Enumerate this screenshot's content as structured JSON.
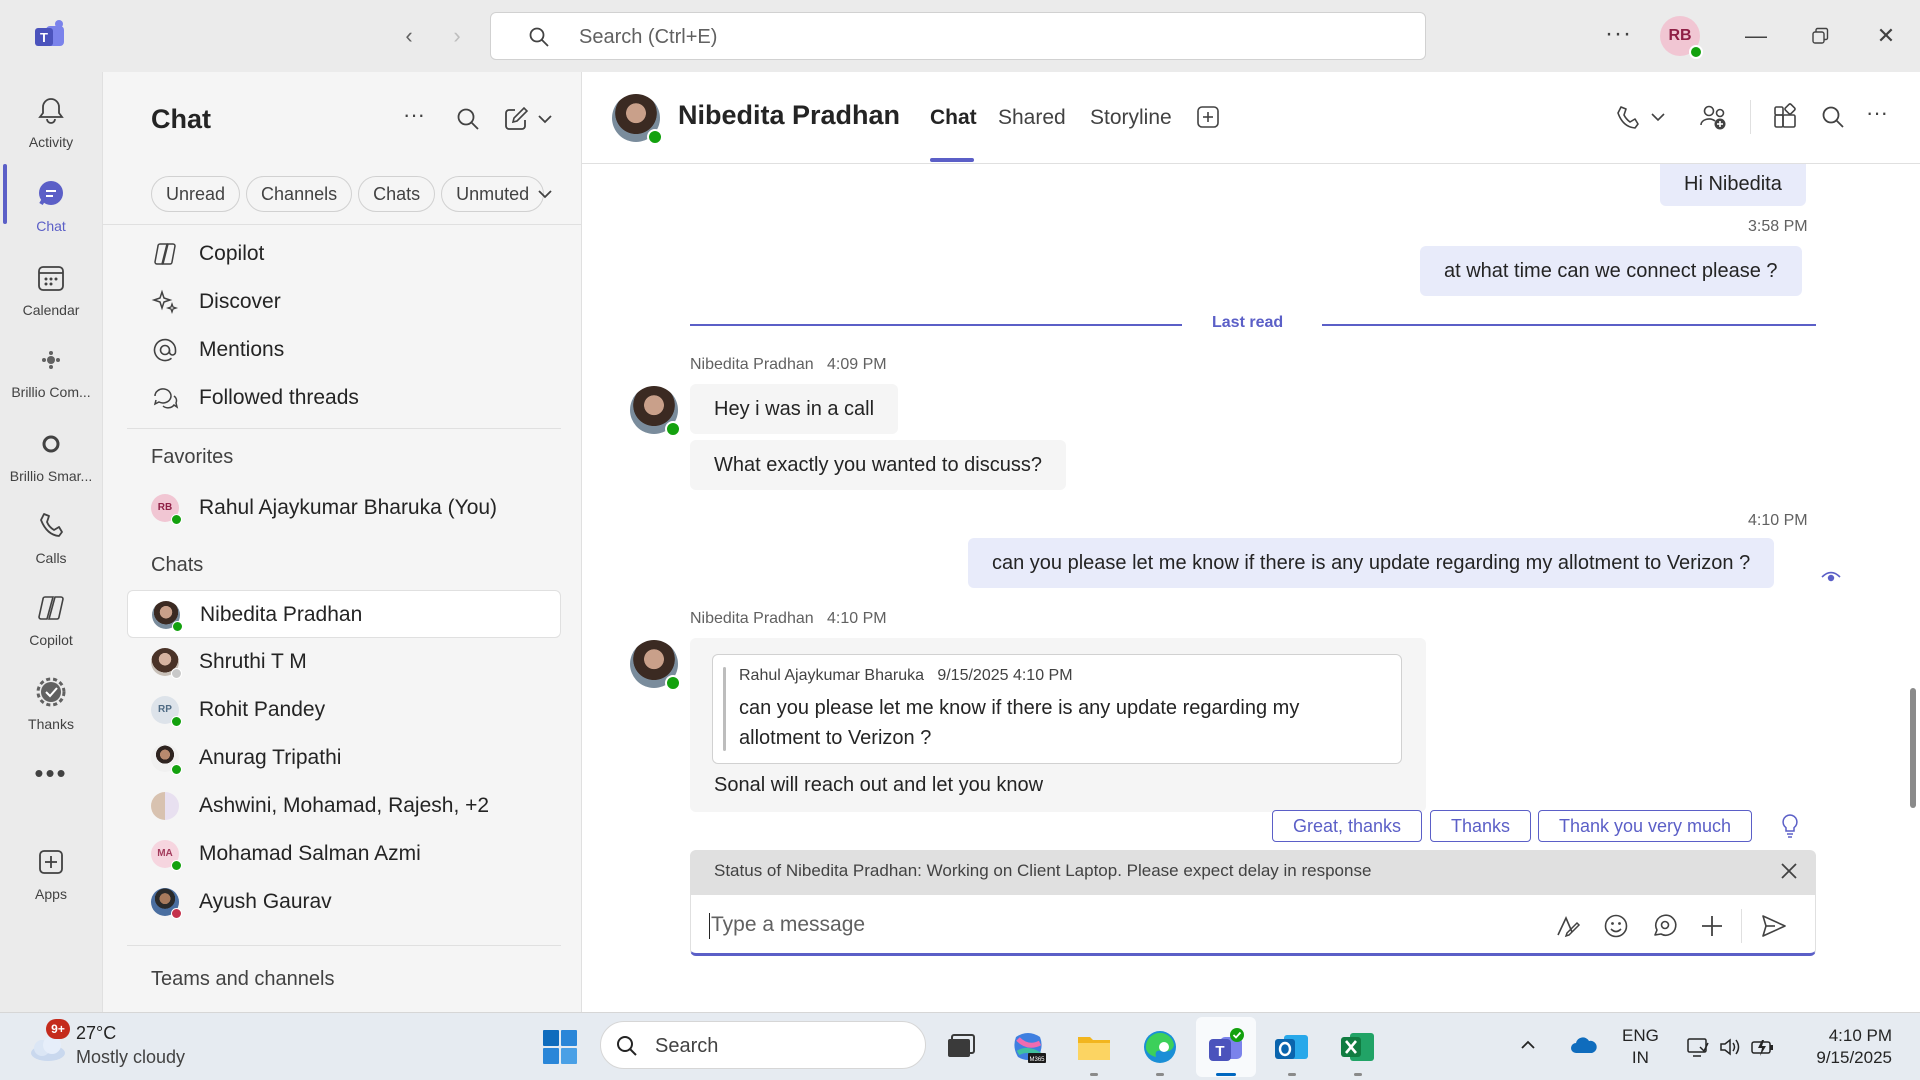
{
  "titlebar": {
    "search_placeholder": "Search (Ctrl+E)",
    "more_label": "···",
    "user_initials": "RB"
  },
  "rail": {
    "items": [
      {
        "label": "Activity",
        "icon": "bell-icon"
      },
      {
        "label": "Chat",
        "icon": "chat-icon"
      },
      {
        "label": "Calendar",
        "icon": "calendar-icon"
      },
      {
        "label": "Brillio Com...",
        "icon": "app-icon"
      },
      {
        "label": "Brillio Smar...",
        "icon": "app-icon"
      },
      {
        "label": "Calls",
        "icon": "phone-icon"
      },
      {
        "label": "Copilot",
        "icon": "copilot-icon"
      },
      {
        "label": "Thanks",
        "icon": "badge-icon"
      },
      {
        "label": "Apps",
        "icon": "add-app-icon"
      }
    ]
  },
  "chatlist": {
    "title": "Chat",
    "filters": [
      "Unread",
      "Channels",
      "Chats",
      "Unmuted"
    ],
    "quick": [
      {
        "label": "Copilot",
        "icon": "copilot-icon"
      },
      {
        "label": "Discover",
        "icon": "sparkle-icon"
      },
      {
        "label": "Mentions",
        "icon": "at-icon"
      },
      {
        "label": "Followed threads",
        "icon": "threads-icon"
      }
    ],
    "favorites_heading": "Favorites",
    "favorites": [
      {
        "name": "Rahul Ajaykumar Bharuka (You)",
        "initials": "RB"
      }
    ],
    "chats_heading": "Chats",
    "chats": [
      {
        "name": "Nibedita Pradhan",
        "initials": "",
        "status": "available"
      },
      {
        "name": "Shruthi T M",
        "initials": "",
        "status": "away"
      },
      {
        "name": "Rohit Pandey",
        "initials": "RP",
        "status": "available"
      },
      {
        "name": "Anurag Tripathi",
        "initials": "",
        "status": "available"
      },
      {
        "name": "Ashwini, Mohamad, Rajesh, +2",
        "initials": "",
        "status": ""
      },
      {
        "name": "Mohamad Salman Azmi",
        "initials": "MA",
        "status": "available"
      },
      {
        "name": "Ayush Gaurav",
        "initials": "",
        "status": "busy"
      }
    ],
    "teams_heading": "Teams and channels"
  },
  "header": {
    "name": "Nibedita Pradhan",
    "tabs": [
      "Chat",
      "Shared",
      "Storyline"
    ]
  },
  "conversation": {
    "msg1": "Hi Nibedita",
    "time2": "3:58 PM",
    "msg2": "at what time can we connect please ?",
    "last_read": "Last read",
    "sender1": "Nibedita Pradhan",
    "sender1_time": "4:09 PM",
    "msg3": "Hey i was in a call",
    "msg4": "What exactly you wanted to discuss?",
    "time5": "4:10 PM",
    "msg5": "can you please let me know if there is any update regarding my allotment to Verizon ?",
    "sender2": "Nibedita Pradhan",
    "sender2_time": "4:10 PM",
    "quote_author": "Rahul Ajaykumar Bharuka",
    "quote_time": "9/15/2025 4:10 PM",
    "quote_text": "can you please let me know if there is any update regarding my allotment to Verizon ?",
    "msg6": "Sonal will reach out and let you know",
    "suggestions": [
      "Great, thanks",
      "Thanks",
      "Thank you very much"
    ],
    "status_banner": "Status of Nibedita Pradhan: Working on Client Laptop. Please expect delay in response",
    "compose_placeholder": "Type a message"
  },
  "taskbar": {
    "badge": "9+",
    "temperature": "27°C",
    "condition": "Mostly cloudy",
    "search": "Search",
    "lang_line1": "ENG",
    "lang_line2": "IN",
    "time": "4:10 PM",
    "date": "9/15/2025"
  },
  "colors": {
    "accent": "#5b5fc7",
    "my_bubble": "#e8ebfa",
    "other_bubble": "#f5f5f5",
    "available": "#13a10e"
  }
}
